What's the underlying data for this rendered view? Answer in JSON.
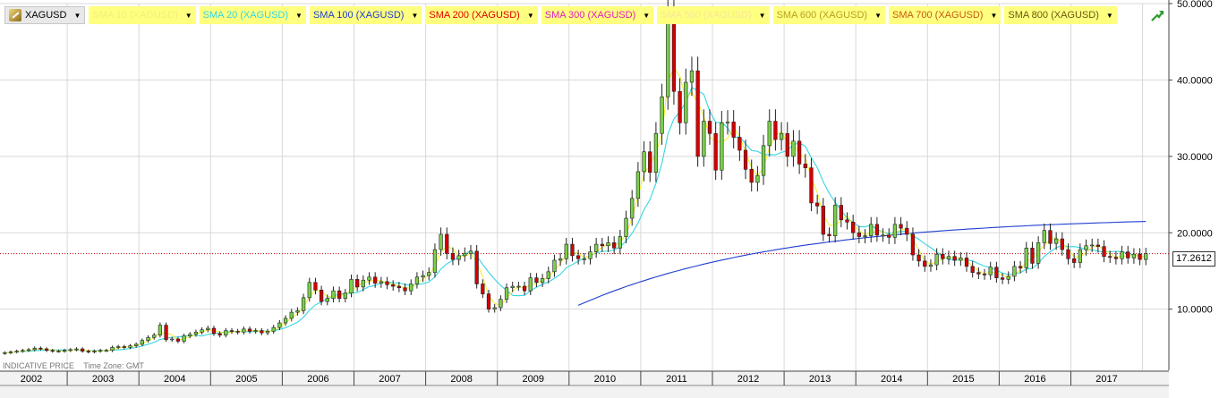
{
  "legend": {
    "main": {
      "label": "XAGUSD",
      "icon": "silver-bar-icon"
    },
    "indicators": [
      {
        "label": "SMA 10 (XAGUSD)",
        "color": "#f2ef7a"
      },
      {
        "label": "SMA 20 (XAGUSD)",
        "color": "#36d6e0"
      },
      {
        "label": "SMA 100 (XAGUSD)",
        "color": "#1f3fd0"
      },
      {
        "label": "SMA 200 (XAGUSD)",
        "color": "#e00000"
      },
      {
        "label": "SMA 300 (XAGUSD)",
        "color": "#e020c0"
      },
      {
        "label": "SMA 500 (XAGUSD)",
        "color": "#f6e89a"
      },
      {
        "label": "SMA 600 (XAGUSD)",
        "color": "#b8a020"
      },
      {
        "label": "SMA 700 (XAGUSD)",
        "color": "#c85a10"
      },
      {
        "label": "SMA 800 (XAGUSD)",
        "color": "#6a5a10"
      }
    ]
  },
  "footer": {
    "price_type": "INDICATIVE PRICE",
    "timezone": "Time Zone: GMT"
  },
  "last_price_label": "17.2612",
  "colors": {
    "up": "#7ad04a",
    "down": "#d40000",
    "wick": "#222222",
    "price_line": "#cc0000"
  },
  "chart_data": {
    "type": "candlestick",
    "symbol": "XAGUSD",
    "interval": "monthly",
    "ylim": [
      2.0,
      50.0
    ],
    "y_ticks": [
      "10.0000",
      "20.0000",
      "30.0000",
      "40.0000",
      "50.0000"
    ],
    "y_tick_values": [
      10,
      20,
      30,
      40,
      50
    ],
    "x_ticks": [
      "2002",
      "2003",
      "2004",
      "2005",
      "2006",
      "2007",
      "2008",
      "2009",
      "2010",
      "2011",
      "2012",
      "2013",
      "2014",
      "2015",
      "2016",
      "2017"
    ],
    "x_start_year": 2002,
    "x_end_year": 2018,
    "grid": true,
    "last_price": 17.2612,
    "candles_per_year": 12,
    "monthly_close": [
      4.3,
      4.4,
      4.5,
      4.6,
      4.7,
      4.9,
      4.8,
      4.6,
      4.5,
      4.5,
      4.6,
      4.7,
      4.8,
      4.5,
      4.4,
      4.5,
      4.6,
      4.6,
      5.0,
      5.1,
      5.0,
      5.2,
      5.4,
      5.9,
      6.3,
      6.6,
      7.9,
      6.0,
      6.1,
      5.8,
      6.5,
      6.7,
      7.0,
      7.3,
      7.5,
      6.8,
      6.6,
      7.2,
      7.1,
      7.0,
      7.4,
      7.1,
      7.2,
      6.9,
      7.1,
      7.6,
      8.2,
      8.8,
      9.6,
      9.8,
      11.5,
      13.5,
      12.5,
      11.0,
      11.4,
      12.4,
      11.4,
      12.1,
      13.9,
      12.9,
      13.8,
      14.2,
      13.4,
      13.6,
      13.2,
      13.0,
      12.8,
      12.4,
      13.3,
      14.2,
      14.4,
      14.8,
      17.8,
      19.8,
      17.3,
      16.5,
      17.0,
      17.3,
      17.6,
      13.3,
      12.0,
      10.0,
      10.2,
      11.3,
      12.8,
      13.0,
      13.0,
      12.4,
      14.1,
      13.5,
      14.0,
      14.9,
      16.4,
      16.6,
      18.5,
      17.0,
      16.6,
      16.6,
      17.5,
      18.5,
      18.3,
      18.7,
      18.0,
      19.5,
      21.9,
      24.5,
      28.0,
      30.6,
      27.9,
      33.0,
      37.8,
      48.5,
      38.5,
      34.4,
      39.7,
      41.2,
      30.0,
      34.6,
      33.0,
      28.2,
      34.4,
      34.5,
      32.5,
      30.8,
      28.3,
      26.6,
      27.5,
      31.4,
      34.6,
      32.2,
      33.0,
      30.0,
      32.0,
      29.0,
      28.5,
      23.9,
      23.5,
      19.8,
      19.6,
      23.6,
      21.7,
      21.4,
      20.0,
      19.5,
      19.6,
      21.1,
      19.7,
      19.7,
      19.4,
      21.1,
      20.6,
      19.8,
      17.1,
      16.3,
      15.6,
      15.8,
      17.2,
      16.6,
      16.9,
      16.4,
      16.7,
      15.6,
      14.8,
      14.6,
      14.5,
      15.5,
      14.1,
      13.9,
      14.3,
      15.6,
      15.4,
      18.0,
      16.0,
      18.7,
      20.3,
      18.6,
      19.2,
      17.8,
      16.6,
      16.1,
      17.8,
      18.3,
      18.4,
      18.2,
      16.9,
      16.8,
      16.6,
      17.5,
      16.7,
      17.2,
      16.5,
      17.26
    ],
    "sma100_start_index": 96
  }
}
